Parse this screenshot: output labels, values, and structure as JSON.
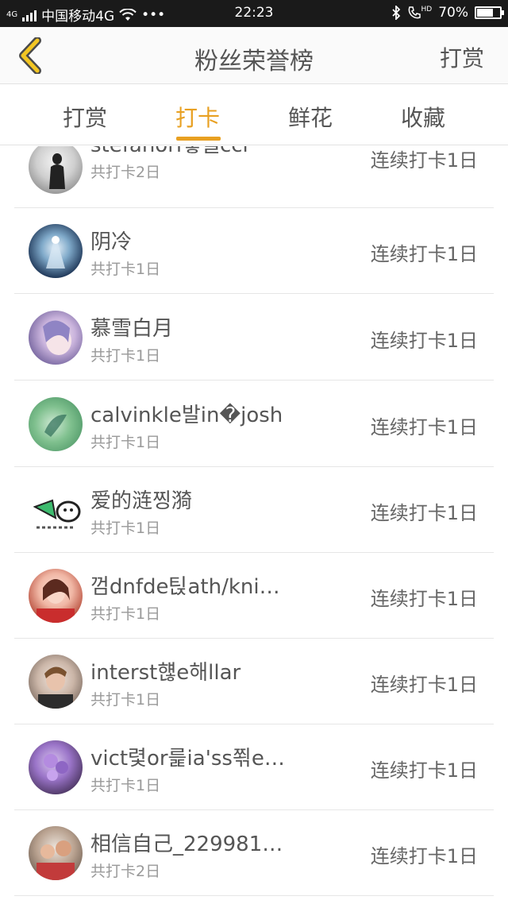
{
  "status_bar": {
    "carrier": "中国移动4G",
    "signal_label": "4G",
    "time": "22:23",
    "hd_label": "HD",
    "battery_text": "70%",
    "battery_level": 0.7
  },
  "nav": {
    "title": "粉丝荣誉榜",
    "action_label": "打赏"
  },
  "tabs": [
    {
      "label": "打赏"
    },
    {
      "label": "打卡"
    },
    {
      "label": "鲜花"
    },
    {
      "label": "收藏"
    }
  ],
  "active_tab": 1,
  "colors": {
    "accent": "#e8a021"
  },
  "rows": [
    {
      "name": "stefanori뵇뼬cci",
      "total": "共打卡2日",
      "streak": "连续打卡1日"
    },
    {
      "name": "阴冷",
      "total": "共打卡1日",
      "streak": "连续打卡1日"
    },
    {
      "name": "慕雪白月",
      "total": "共打卡1日",
      "streak": "连续打卡1日"
    },
    {
      "name": "calvinkle발in�josh",
      "total": "共打卡1日",
      "streak": "连续打卡1日"
    },
    {
      "name": "爱的涟찡漪",
      "total": "共打卡1日",
      "streak": "连续打卡1日"
    },
    {
      "name": "껌dnfde틵ath/knig…",
      "total": "共打卡1日",
      "streak": "连续打卡1日"
    },
    {
      "name": "interst햲e해llar",
      "total": "共打卡1日",
      "streak": "连续打卡1日"
    },
    {
      "name": "vict렻or릁ia'ss쬒ec…",
      "total": "共打卡1日",
      "streak": "连续打卡1日"
    },
    {
      "name": "相信自己_229981…",
      "total": "共打卡2日",
      "streak": "连续打卡1日"
    }
  ]
}
